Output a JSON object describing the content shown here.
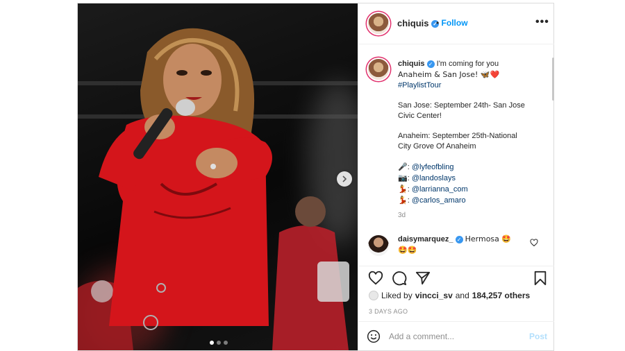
{
  "post": {
    "author": "chiquis",
    "follow_label": "Follow",
    "bullet": "•",
    "more_label": "•••",
    "carousel": {
      "slide_count": 3,
      "active_index": 0
    },
    "caption": {
      "author": "chiquis",
      "line1": "I'm coming for you",
      "line2": "Anaheim & San Jose! 🦋❤️",
      "hashtag": "#PlaylistTour",
      "sj_line1": "San Jose: September 24th- San Jose",
      "sj_line2": "Civic Center!",
      "an_line1": "Anaheim: September 25th-National",
      "an_line2": "City Grove Of Anaheim",
      "credits": [
        {
          "icon": "🎤",
          "handle": "@lyfeofbling"
        },
        {
          "icon": "📷",
          "handle": "@landoslays"
        },
        {
          "icon": "💃",
          "handle": "@larrianna_com"
        },
        {
          "icon": "💃",
          "handle": "@carlos_amaro"
        }
      ],
      "time": "3d"
    },
    "comment": {
      "user": "daisymarquez_",
      "text": "Hermosa 🤩",
      "text2": "🤩🤩"
    },
    "likes": {
      "prefix": "Liked by",
      "user": "vincci_sv",
      "middle": "and",
      "count": "184,257 others"
    },
    "posted": "3 DAYS AGO",
    "add_comment": {
      "placeholder": "Add a comment...",
      "post_label": "Post"
    }
  },
  "colors": {
    "accent": "#0095f6",
    "verified": "#3897f0",
    "link": "#00376b",
    "muted": "#8e8e8e",
    "border": "#dbdbdb"
  },
  "icons": [
    "verified-badge-icon",
    "more-options-icon",
    "carousel-next-icon",
    "like-heart-icon",
    "comment-icon",
    "share-icon",
    "bookmark-icon",
    "emoji-icon",
    "comment-like-icon"
  ]
}
